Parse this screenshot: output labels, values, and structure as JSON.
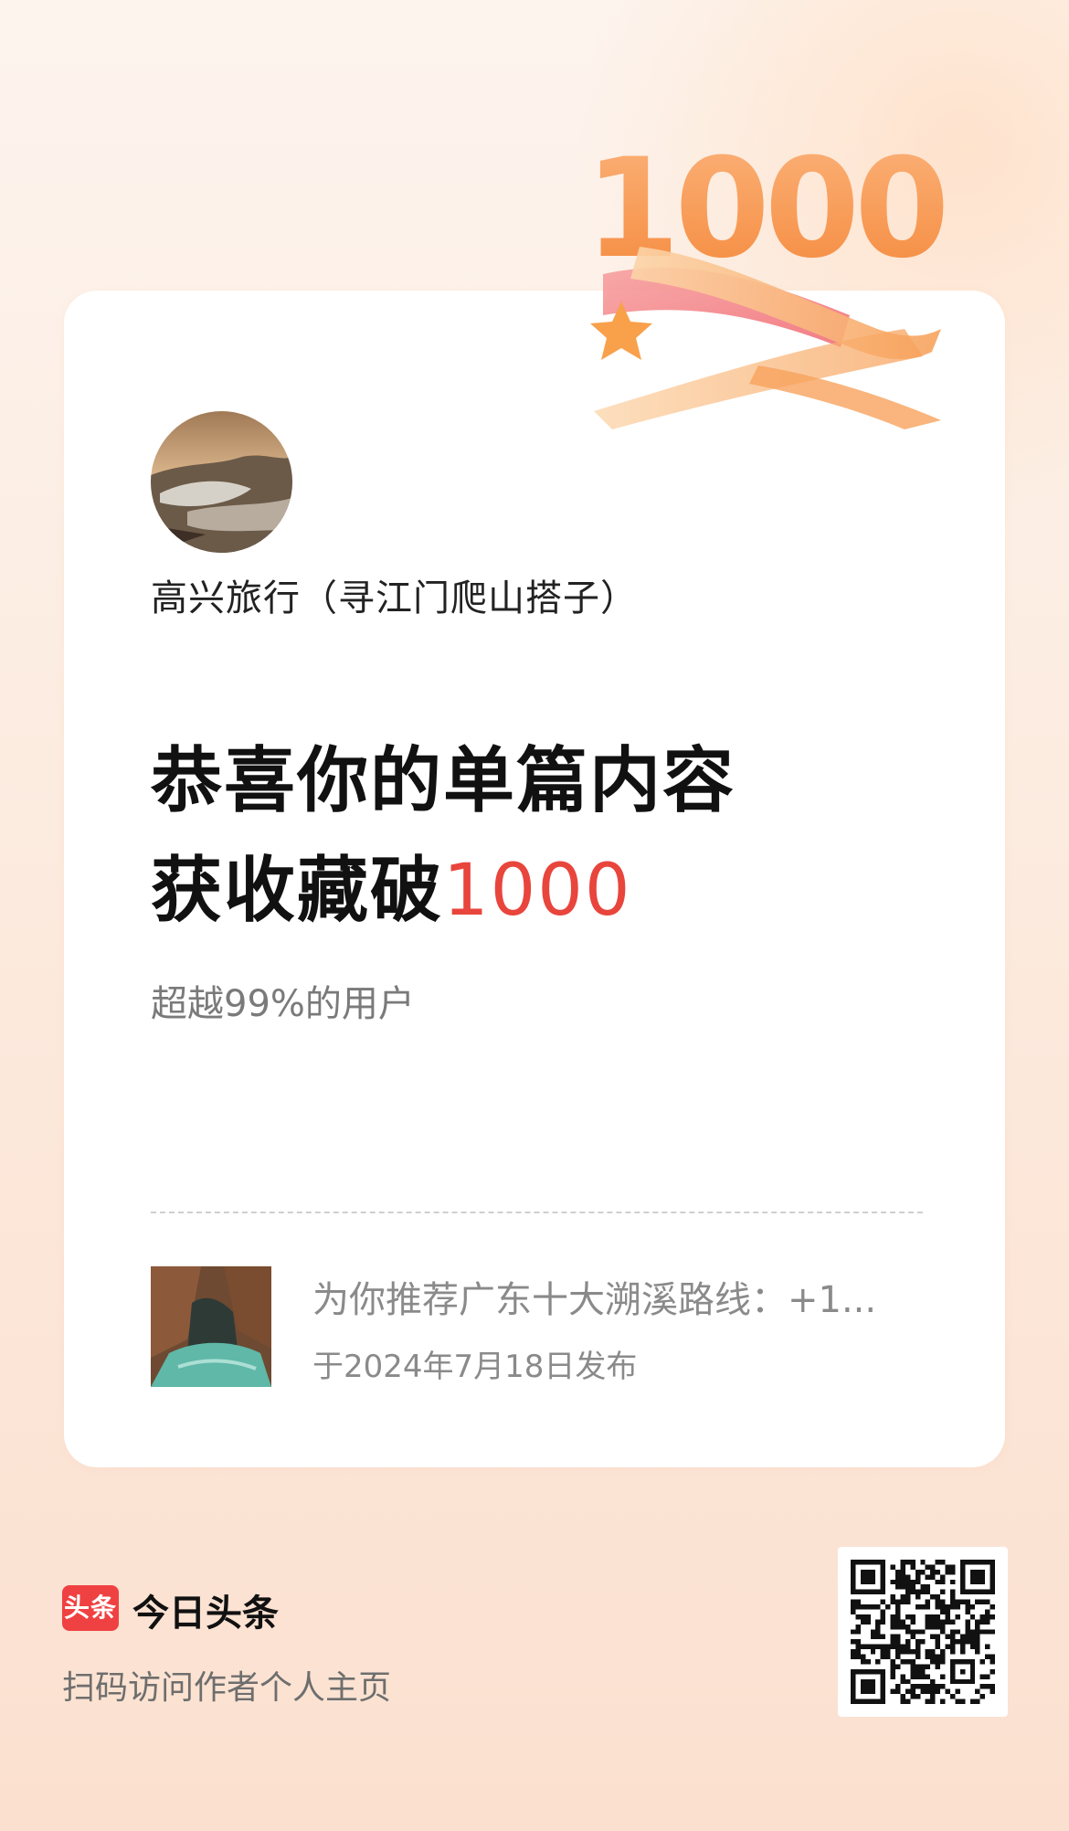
{
  "badge": {
    "number_graphic": "1000"
  },
  "author": {
    "name": "高兴旅行（寻江门爬山搭子）"
  },
  "headline": {
    "line1": "恭喜你的单篇内容",
    "line2_prefix": "获收藏破",
    "line2_number": "1000"
  },
  "subline": "超越99%的用户",
  "article": {
    "title": "为你推荐广东十大溯溪路线：+1...",
    "date": "于2024年7月18日发布"
  },
  "footer": {
    "logo_text": "头条",
    "brand_name": "今日头条",
    "scan_hint": "扫码访问作者个人主页"
  },
  "colors": {
    "accent_red": "#e8453c",
    "badge_orange": "#f6924a",
    "brand_red": "#f04142"
  },
  "icons": {
    "avatar": "avatar-image",
    "article_thumb": "article-thumbnail",
    "qr": "qr-code"
  }
}
